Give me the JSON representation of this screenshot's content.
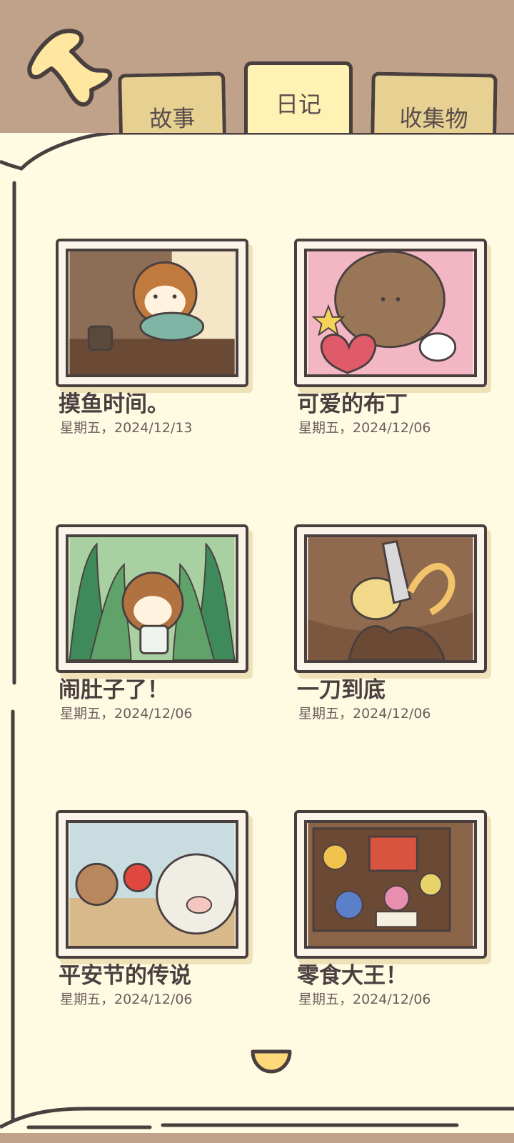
{
  "tabs": {
    "story": "故事",
    "diary": "日记",
    "collection": "收集物"
  },
  "entries": [
    {
      "title": "摸鱼时间。",
      "date": "星期五，2024/12/13",
      "image": "squirrel-holding-fish"
    },
    {
      "title": "可爱的布丁",
      "date": "星期五，2024/12/06",
      "image": "dog-with-plush-and-stickers"
    },
    {
      "title": "闹肚子了！",
      "date": "星期五，2024/12/06",
      "image": "squirrel-with-toilet-paper"
    },
    {
      "title": "一刀到底",
      "date": "星期五，2024/12/06",
      "image": "knife-peeling-fruit"
    },
    {
      "title": "平安节的传说",
      "date": "星期五，2024/12/06",
      "image": "rabbit-apple-sheep"
    },
    {
      "title": "零食大王！",
      "date": "星期五，2024/12/06",
      "image": "snack-box"
    }
  ],
  "icons": {
    "back": "back-arrow-icon",
    "scroll": "scroll-down-icon"
  },
  "colors": {
    "header": "#c0a189",
    "paper": "#fffbe2",
    "tab": "#e6d192",
    "tab_active": "#fff2b4",
    "outline": "#4a3f3f"
  }
}
